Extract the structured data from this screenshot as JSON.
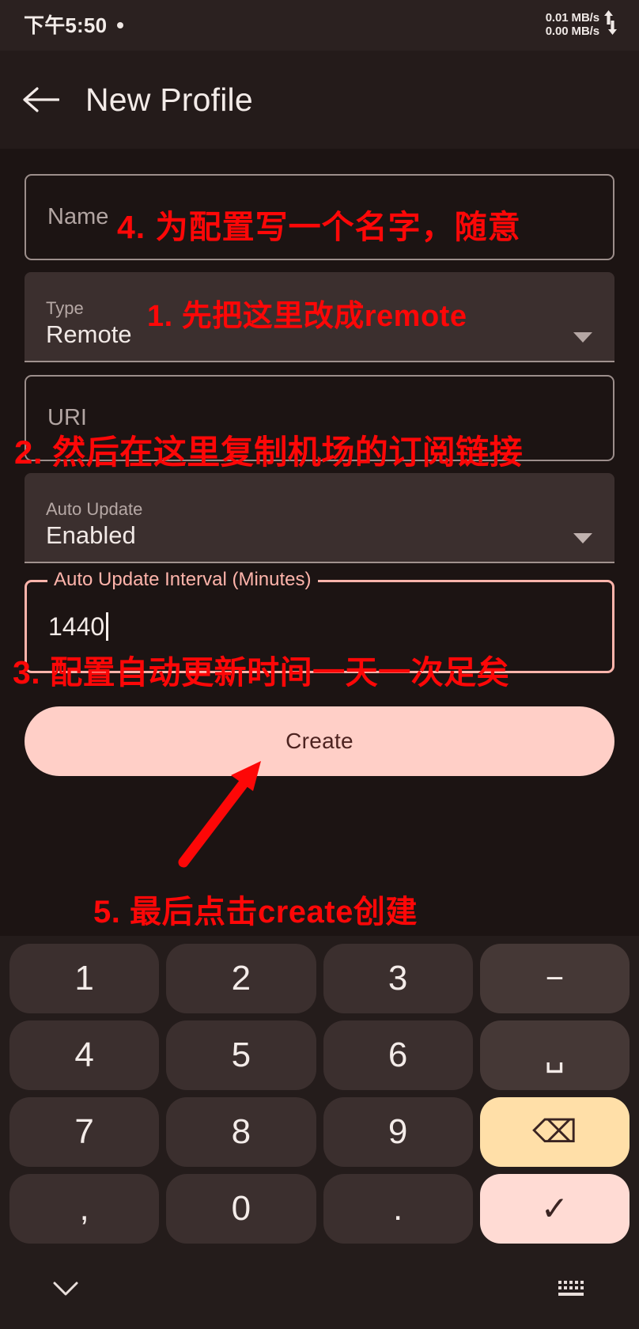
{
  "status_bar": {
    "clock": "下午5:50",
    "dot_icon": "dot-icon",
    "upload_speed": "0.01 MB/s",
    "download_speed": "0.00 MB/s",
    "upload_icon": "arrow-up-icon",
    "download_icon": "arrow-down-icon"
  },
  "app_bar": {
    "back_icon": "arrow-left-icon",
    "title": "New Profile"
  },
  "form": {
    "name_field": {
      "placeholder": "Name",
      "value": ""
    },
    "type_field": {
      "label": "Type",
      "value": "Remote",
      "caret_icon": "chevron-down-icon"
    },
    "uri_field": {
      "placeholder": "URI",
      "value": ""
    },
    "auto_update_field": {
      "label": "Auto Update",
      "value": "Enabled",
      "caret_icon": "chevron-down-icon"
    },
    "interval_field": {
      "label": "Auto Update Interval (Minutes)",
      "value": "1440"
    },
    "create_button": "Create"
  },
  "annotations": [
    {
      "id": "anno-1",
      "text": "1. 先把这里改成remote"
    },
    {
      "id": "anno-2",
      "text": "2. 然后在这里复制机场的订阅链接"
    },
    {
      "id": "anno-3",
      "text": "3. 配置自动更新时间一天一次足矣"
    },
    {
      "id": "anno-4",
      "text": "4. 为配置写一个名字，随意"
    },
    {
      "id": "anno-5",
      "text": "5. 最后点击create创建"
    }
  ],
  "keyboard": {
    "rows": [
      [
        {
          "glyph": "1",
          "name": "key-1",
          "type": "digit"
        },
        {
          "glyph": "2",
          "name": "key-2",
          "type": "digit"
        },
        {
          "glyph": "3",
          "name": "key-3",
          "type": "digit"
        },
        {
          "glyph": "−",
          "name": "key-minus",
          "type": "func"
        }
      ],
      [
        {
          "glyph": "4",
          "name": "key-4",
          "type": "digit"
        },
        {
          "glyph": "5",
          "name": "key-5",
          "type": "digit"
        },
        {
          "glyph": "6",
          "name": "key-6",
          "type": "digit"
        },
        {
          "glyph": "␣",
          "name": "key-space",
          "type": "func"
        }
      ],
      [
        {
          "glyph": "7",
          "name": "key-7",
          "type": "digit"
        },
        {
          "glyph": "8",
          "name": "key-8",
          "type": "digit"
        },
        {
          "glyph": "9",
          "name": "key-9",
          "type": "digit"
        },
        {
          "glyph": "⌫",
          "name": "key-backspace",
          "type": "backspace"
        }
      ],
      [
        {
          "glyph": ",",
          "name": "key-comma",
          "type": "digit"
        },
        {
          "glyph": "0",
          "name": "key-0",
          "type": "digit"
        },
        {
          "glyph": ".",
          "name": "key-period",
          "type": "digit"
        },
        {
          "glyph": "✓",
          "name": "key-enter",
          "type": "enter"
        }
      ]
    ],
    "bottom_bar": {
      "hide_icon": "chevron-down-icon",
      "switch_icon": "keyboard-icon"
    }
  },
  "colors": {
    "background": "#1c1413",
    "status_bar": "#2b2120",
    "app_bar": "#241b1a",
    "field_filled": "#3b2f2e",
    "accent_pink": "#ffb4ab",
    "create_button": "#ffcfc7",
    "backspace_key": "#ffdfa8",
    "enter_key": "#ffdbd4",
    "key": "#3b2f2e",
    "annotation_red": "#fd0707"
  }
}
